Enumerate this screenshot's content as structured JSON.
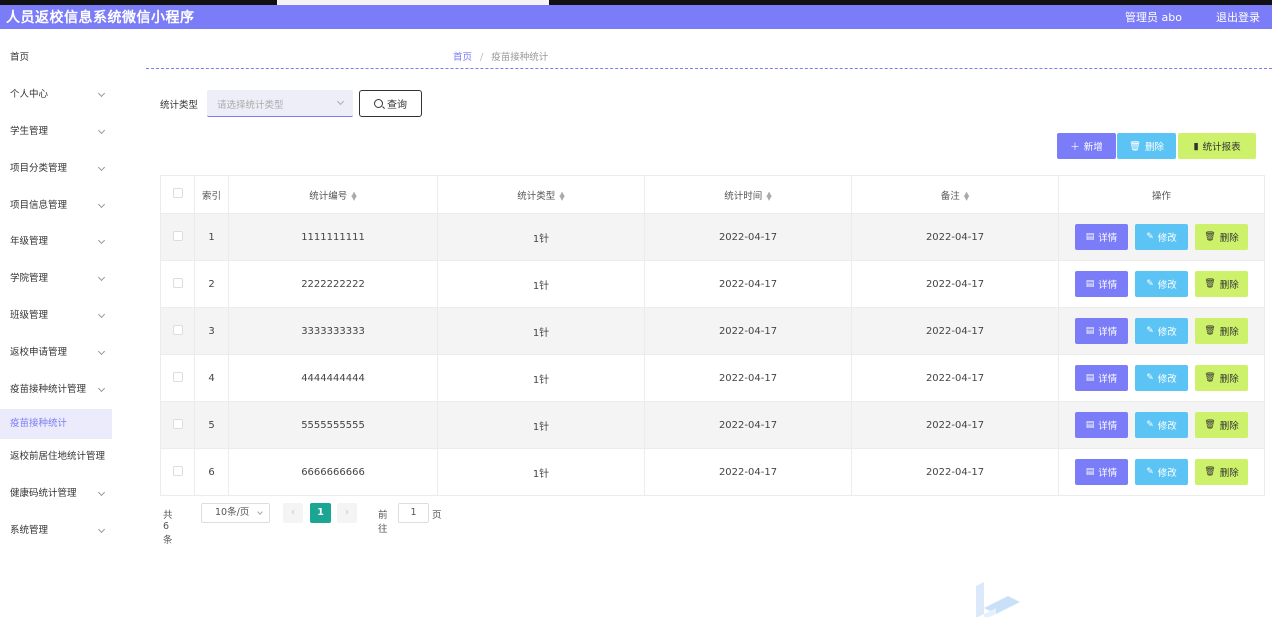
{
  "header": {
    "title": "人员返校信息系统微信小程序",
    "user": "管理员 abo",
    "logout": "退出登录"
  },
  "sidebar": {
    "items": [
      {
        "label": "首页",
        "has_arrow": false
      },
      {
        "label": "个人中心",
        "has_arrow": true
      },
      {
        "label": "学生管理",
        "has_arrow": true
      },
      {
        "label": "项目分类管理",
        "has_arrow": true
      },
      {
        "label": "项目信息管理",
        "has_arrow": true
      },
      {
        "label": "年级管理",
        "has_arrow": true
      },
      {
        "label": "学院管理",
        "has_arrow": true
      },
      {
        "label": "班级管理",
        "has_arrow": true
      },
      {
        "label": "返校申请管理",
        "has_arrow": true
      },
      {
        "label": "疫苗接种统计管理",
        "has_arrow": true
      },
      {
        "label": "疫苗接种统计",
        "has_arrow": false,
        "active": true
      },
      {
        "label": "返校前居住地统计管理",
        "has_arrow": false
      },
      {
        "label": "健康码统计管理",
        "has_arrow": true
      },
      {
        "label": "系统管理",
        "has_arrow": true
      }
    ]
  },
  "breadcrumb": {
    "home": "首页",
    "current": "疫苗接种统计"
  },
  "search": {
    "label": "统计类型",
    "placeholder": "请选择统计类型",
    "button": "查询"
  },
  "toolbar": {
    "add": "新增",
    "delete": "删除",
    "report": "统计报表"
  },
  "table": {
    "headers": {
      "index": "索引",
      "code": "统计编号",
      "type": "统计类型",
      "time": "统计时间",
      "remark": "备注",
      "ops": "操作"
    },
    "rows": [
      {
        "index": "1",
        "code": "1111111111",
        "type": "1针",
        "time": "2022-04-17",
        "remark": "2022-04-17"
      },
      {
        "index": "2",
        "code": "2222222222",
        "type": "1针",
        "time": "2022-04-17",
        "remark": "2022-04-17"
      },
      {
        "index": "3",
        "code": "3333333333",
        "type": "1针",
        "time": "2022-04-17",
        "remark": "2022-04-17"
      },
      {
        "index": "4",
        "code": "4444444444",
        "type": "1针",
        "time": "2022-04-17",
        "remark": "2022-04-17"
      },
      {
        "index": "5",
        "code": "5555555555",
        "type": "1针",
        "time": "2022-04-17",
        "remark": "2022-04-17"
      },
      {
        "index": "6",
        "code": "6666666666",
        "type": "1针",
        "time": "2022-04-17",
        "remark": "2022-04-17"
      }
    ],
    "ops": {
      "detail": "详情",
      "edit": "修改",
      "delete": "删除"
    }
  },
  "pagination": {
    "total": "共 6 条",
    "page_size": "10条/页",
    "current": "1",
    "goto": "前往",
    "goto_value": "1",
    "page_suffix": "页"
  },
  "colors": {
    "primary": "#7b7cf7",
    "info": "#5bc4f5",
    "lime": "#cdf16b",
    "page_active": "#1aa692"
  }
}
